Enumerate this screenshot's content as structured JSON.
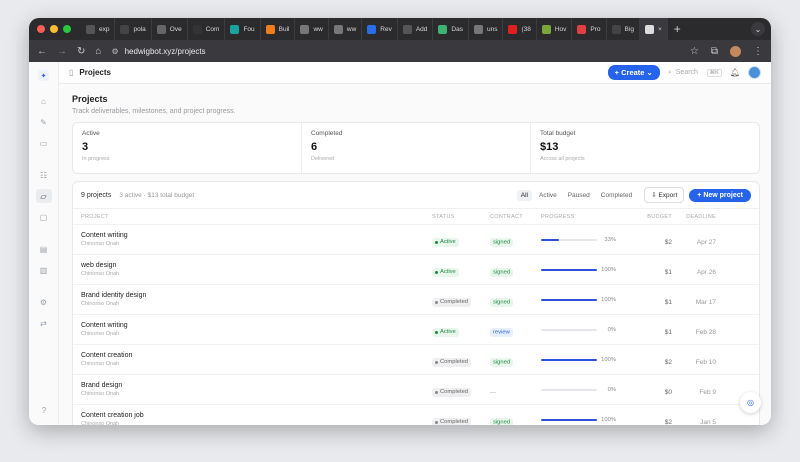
{
  "browser": {
    "tabs": [
      {
        "label": "exp",
        "color": "#555555"
      },
      {
        "label": "pola",
        "color": "#444444"
      },
      {
        "label": "Ove",
        "color": "#666666"
      },
      {
        "label": "Com",
        "color": "#333333"
      },
      {
        "label": "Fou",
        "color": "#1aa1a1"
      },
      {
        "label": "Buil",
        "color": "#f07c1a"
      },
      {
        "label": "ww",
        "color": "#777777"
      },
      {
        "label": "ww",
        "color": "#777777"
      },
      {
        "label": "Rev",
        "color": "#2b6de8"
      },
      {
        "label": "Add",
        "color": "#555555"
      },
      {
        "label": "Das",
        "color": "#3cb371"
      },
      {
        "label": "uns",
        "color": "#777777"
      },
      {
        "label": "(38",
        "color": "#e02020"
      },
      {
        "label": "Hov",
        "color": "#7aa63a"
      },
      {
        "label": "Pro",
        "color": "#e04040"
      },
      {
        "label": "Big",
        "color": "#444444"
      },
      {
        "label": "×",
        "color": "#dddddd"
      }
    ],
    "url": "hedwigbot.xyz/projects"
  },
  "header": {
    "title": "Projects",
    "create_label": "Create",
    "search_placeholder": "Search",
    "search_shortcut": "⌘K"
  },
  "page": {
    "title": "Projects",
    "subtitle": "Track deliverables, milestones, and project progress."
  },
  "stats": [
    {
      "label": "Active",
      "value": "3",
      "note": "In progress"
    },
    {
      "label": "Completed",
      "value": "6",
      "note": "Delivered"
    },
    {
      "label": "Total budget",
      "value": "$13",
      "note": "Across all projects"
    }
  ],
  "projects_card": {
    "count": "9 projects",
    "meta": "3 active · $13 total budget",
    "filters": [
      "All",
      "Active",
      "Paused",
      "Completed"
    ],
    "active_filter": "All",
    "export_label": "Export",
    "new_label": "New project",
    "columns": [
      "PROJECT",
      "STATUS",
      "CONTRACT",
      "PROGRESS",
      "BUDGET",
      "DEADLINE"
    ],
    "rows": [
      {
        "name": "Content writing",
        "owner": "Chinonso Onah",
        "status": "Active",
        "contract": "signed",
        "progress": 33,
        "progress_text": "33%",
        "budget": "$2",
        "deadline": "Apr 27"
      },
      {
        "name": "web design",
        "owner": "Chinonso Onah",
        "status": "Active",
        "contract": "signed",
        "progress": 100,
        "progress_text": "100%",
        "budget": "$1",
        "deadline": "Apr 26"
      },
      {
        "name": "Brand identity design",
        "owner": "Chinonso Onah",
        "status": "Completed",
        "contract": "signed",
        "progress": 100,
        "progress_text": "100%",
        "budget": "$1",
        "deadline": "Mar 17"
      },
      {
        "name": "Content writing",
        "owner": "Chinonso Onah",
        "status": "Active",
        "contract": "review",
        "progress": 0,
        "progress_text": "0%",
        "budget": "$1",
        "deadline": "Feb 28"
      },
      {
        "name": "Content creation",
        "owner": "Chinonso Onah",
        "status": "Completed",
        "contract": "signed",
        "progress": 100,
        "progress_text": "100%",
        "budget": "$2",
        "deadline": "Feb 10"
      },
      {
        "name": "Brand design",
        "owner": "Chinonso Onah",
        "status": "Completed",
        "contract": "—",
        "progress": 0,
        "progress_text": "0%",
        "budget": "$0",
        "deadline": "Feb 9"
      },
      {
        "name": "Content creation job",
        "owner": "Chinonso Onah",
        "status": "Completed",
        "contract": "signed",
        "progress": 100,
        "progress_text": "100%",
        "budget": "$2",
        "deadline": "Jan 5"
      }
    ]
  },
  "colors": {
    "accent": "#2563eb",
    "active_green": "#1f8a43",
    "progress_fill": "#2f4fd8"
  }
}
